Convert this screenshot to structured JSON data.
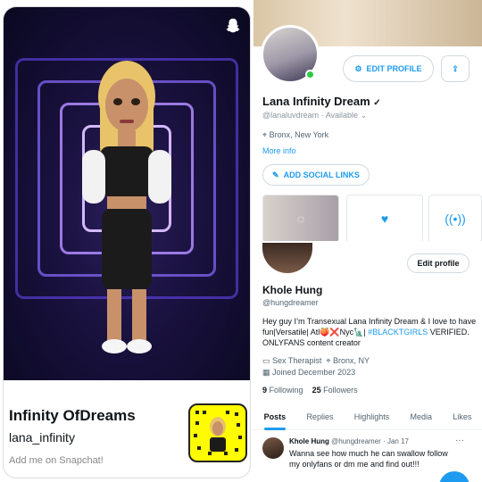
{
  "snapchat": {
    "display_name": "Infinity OfDreams",
    "username": "lana_infinity",
    "add_text": "Add me on Snapchat!",
    "ghost_icon": "snapchat-ghost-icon"
  },
  "twitter_top": {
    "edit_profile_label": "EDIT PROFILE",
    "name": "Lana Infinity Dream",
    "handle": "@lanaluvdream",
    "availability": "Available",
    "location": "Bronx, New York",
    "more_info": "More info",
    "add_social_label": "ADD SOCIAL LINKS",
    "accent": "#1d9bf0"
  },
  "twitter_bottom": {
    "edit_profile_label": "Edit profile",
    "name": "Khole Hung",
    "handle": "@hungdreamer",
    "bio_text": "Hey guy I’m Transexual Lana Infinity Dream & I love to have fun|Versatile| Atl🍑❌Nyc🗽|",
    "bio_hashtag": "#BLACKTGIRLS",
    "bio_end": "VERIFIED. ONLYFANS content creator",
    "occupation": "Sex Therapist",
    "location": "Bronx, NY",
    "joined": "Joined December 2023",
    "following_count": "9",
    "following_label": "Following",
    "followers_count": "25",
    "followers_label": "Followers",
    "tabs": [
      "Posts",
      "Replies",
      "Highlights",
      "Media",
      "Likes"
    ],
    "post": {
      "author": "Khole Hung",
      "handle": "@hungdreamer",
      "time": "· Jan 17",
      "text": "Wanna see how much he can swallow follow my onlyfans or dm me and find out!!!"
    }
  }
}
